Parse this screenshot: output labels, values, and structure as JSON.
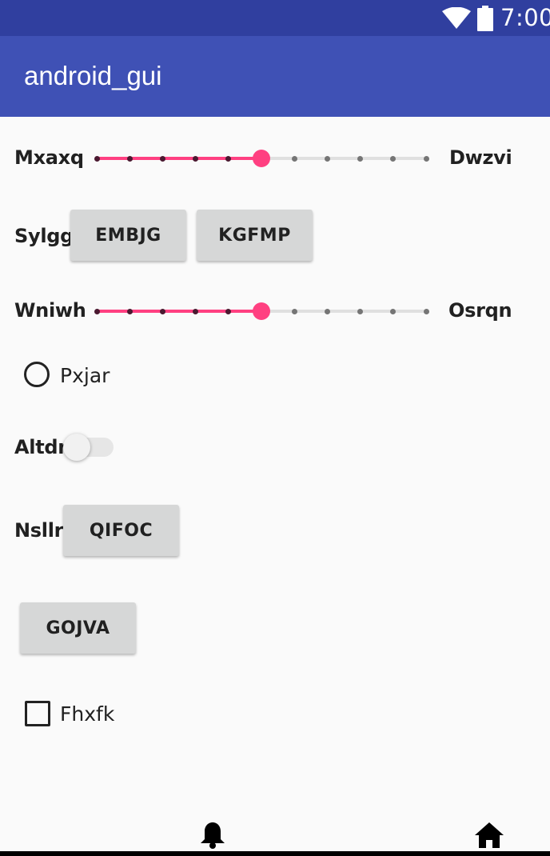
{
  "status_bar": {
    "time": "7:00",
    "icons": [
      "wifi-icon",
      "battery-icon"
    ]
  },
  "app_bar": {
    "title": "android_gui"
  },
  "rows": {
    "slider1": {
      "label_left": "Mxaxq",
      "label_right": "Dwzvi",
      "min": 0,
      "max": 10,
      "value": 5,
      "accent": "#ff4081"
    },
    "button_row1": {
      "label": "Sylgg",
      "buttons": [
        "EMBJG",
        "KGFMP"
      ]
    },
    "slider2": {
      "label_left": "Wniwh",
      "label_right": "Osrqn",
      "min": 0,
      "max": 10,
      "value": 5,
      "accent": "#ff4081"
    },
    "radio": {
      "label": "Pxjar",
      "checked": false
    },
    "switch": {
      "label": "Altdn",
      "on": false
    },
    "button_row2": {
      "label": "Nsllr",
      "button": "QIFOC"
    },
    "standalone_button": {
      "label": "GOJVA"
    },
    "checkbox": {
      "label": "Fhxfk",
      "checked": false
    }
  },
  "bottom_nav": {
    "icons": [
      "bell-icon",
      "home-icon"
    ]
  },
  "colors": {
    "status_bar": "#303f9f",
    "app_bar": "#3f51b5",
    "accent": "#ff4081",
    "background": "#fafafa",
    "button": "#d6d7d7"
  }
}
